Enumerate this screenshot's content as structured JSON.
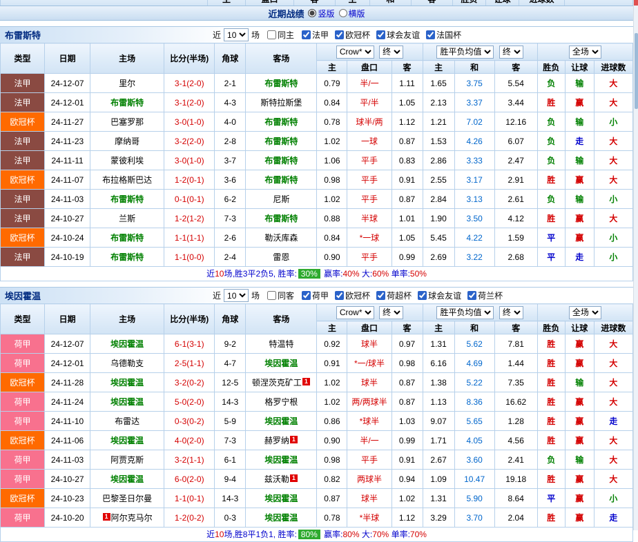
{
  "top_bar": {
    "title": "近期战绩",
    "vertical": "竖版",
    "horizontal": "横版"
  },
  "columns": {
    "type": "类型",
    "date": "日期",
    "home": "主场",
    "score": "比分(半场)",
    "corner": "角球",
    "away": "客场",
    "sub": [
      "主",
      "盘口",
      "客",
      "主",
      "和",
      "客",
      "胜负",
      "让球",
      "进球数"
    ]
  },
  "controls": {
    "company": "Crow*",
    "final_a": "终",
    "avg": "胜平负均值",
    "final_b": "终",
    "scope": "全场"
  },
  "colors": {
    "win": "#d40000",
    "draw": "#0000cc",
    "loss": "#008000",
    "league_ligue1": "#8a4a42",
    "league_ucl": "#ff6a00",
    "league_eredivisie": "#f8718e",
    "tracked_team": "#008000",
    "summary_badge": "#2eaa2e",
    "red_card_badge": "#e00000"
  },
  "sections": [
    {
      "team": "布雷斯特",
      "filter": {
        "prefix": "近",
        "count": "10",
        "suffix": "场",
        "same_label": "同主",
        "leagues": [
          "法甲",
          "欧冠杯",
          "球会友谊",
          "法国杯"
        ]
      },
      "rows": [
        {
          "type": "法甲",
          "date": "24-12-07",
          "home": "里尔",
          "home_t": false,
          "score": "3-1(2-0)",
          "corner": "2-1",
          "away": "布雷斯特",
          "away_t": true,
          "h1": "0.79",
          "hcap": "半/一",
          "h2": "1.11",
          "e1": "1.65",
          "e2": "3.75",
          "e3": "5.54",
          "r1": "负",
          "r2": "输",
          "r3": "大"
        },
        {
          "type": "法甲",
          "date": "24-12-01",
          "home": "布雷斯特",
          "home_t": true,
          "score": "3-1(2-0)",
          "corner": "4-3",
          "away": "斯特拉斯堡",
          "away_t": false,
          "h1": "0.84",
          "hcap": "平/半",
          "h2": "1.05",
          "e1": "2.13",
          "e2": "3.37",
          "e3": "3.44",
          "r1": "胜",
          "r2": "赢",
          "r3": "大"
        },
        {
          "type": "欧冠杯",
          "date": "24-11-27",
          "home": "巴塞罗那",
          "home_t": false,
          "score": "3-0(1-0)",
          "corner": "4-0",
          "away": "布雷斯特",
          "away_t": true,
          "h1": "0.78",
          "hcap": "球半/两",
          "h2": "1.12",
          "e1": "1.21",
          "e2": "7.02",
          "e3": "12.16",
          "r1": "负",
          "r2": "输",
          "r3": "小"
        },
        {
          "type": "法甲",
          "date": "24-11-23",
          "home": "摩纳哥",
          "home_t": false,
          "score": "3-2(2-0)",
          "corner": "2-8",
          "away": "布雷斯特",
          "away_t": true,
          "h1": "1.02",
          "hcap": "一球",
          "h2": "0.87",
          "e1": "1.53",
          "e2": "4.26",
          "e3": "6.07",
          "r1": "负",
          "r2": "走",
          "r3": "大"
        },
        {
          "type": "法甲",
          "date": "24-11-11",
          "home": "蒙彼利埃",
          "home_t": false,
          "score": "3-0(1-0)",
          "corner": "3-7",
          "away": "布雷斯特",
          "away_t": true,
          "h1": "1.06",
          "hcap": "平手",
          "h2": "0.83",
          "e1": "2.86",
          "e2": "3.33",
          "e3": "2.47",
          "r1": "负",
          "r2": "输",
          "r3": "大"
        },
        {
          "type": "欧冠杯",
          "date": "24-11-07",
          "home": "布拉格斯巴达",
          "home_t": false,
          "score": "1-2(0-1)",
          "corner": "3-6",
          "away": "布雷斯特",
          "away_t": true,
          "h1": "0.98",
          "hcap": "平手",
          "h2": "0.91",
          "e1": "2.55",
          "e2": "3.17",
          "e3": "2.91",
          "r1": "胜",
          "r2": "赢",
          "r3": "大"
        },
        {
          "type": "法甲",
          "date": "24-11-03",
          "home": "布雷斯特",
          "home_t": true,
          "score": "0-1(0-1)",
          "corner": "6-2",
          "away": "尼斯",
          "away_t": false,
          "h1": "1.02",
          "hcap": "平手",
          "h2": "0.87",
          "e1": "2.84",
          "e2": "3.13",
          "e3": "2.61",
          "r1": "负",
          "r2": "输",
          "r3": "小"
        },
        {
          "type": "法甲",
          "date": "24-10-27",
          "home": "兰斯",
          "home_t": false,
          "score": "1-2(1-2)",
          "corner": "7-3",
          "away": "布雷斯特",
          "away_t": true,
          "h1": "0.88",
          "hcap": "半球",
          "h2": "1.01",
          "e1": "1.90",
          "e2": "3.50",
          "e3": "4.12",
          "r1": "胜",
          "r2": "赢",
          "r3": "大"
        },
        {
          "type": "欧冠杯",
          "date": "24-10-24",
          "home": "布雷斯特",
          "home_t": true,
          "score": "1-1(1-1)",
          "corner": "2-6",
          "away": "勒沃库森",
          "away_t": false,
          "h1": "0.84",
          "hcap": "*一球",
          "h2": "1.05",
          "e1": "5.45",
          "e2": "4.22",
          "e3": "1.59",
          "r1": "平",
          "r2": "赢",
          "r3": "小"
        },
        {
          "type": "法甲",
          "date": "24-10-19",
          "home": "布雷斯特",
          "home_t": true,
          "score": "1-1(0-0)",
          "corner": "2-4",
          "away": "雷恩",
          "away_t": false,
          "h1": "0.90",
          "hcap": "平手",
          "h2": "0.99",
          "e1": "2.69",
          "e2": "3.22",
          "e3": "2.68",
          "r1": "平",
          "r2": "走",
          "r3": "小"
        }
      ],
      "summary": [
        {
          "t": "近",
          "c": "b"
        },
        {
          "t": "10",
          "c": "r"
        },
        {
          "t": "场,胜3平2负5, 胜率:",
          "c": "b"
        },
        {
          "t": "30%",
          "c": "w",
          "badge": true
        },
        {
          "t": " 赢率:",
          "c": "b"
        },
        {
          "t": "40%",
          "c": "r"
        },
        {
          "t": " 大:",
          "c": "b"
        },
        {
          "t": "60%",
          "c": "r"
        },
        {
          "t": " 单率:",
          "c": "b"
        },
        {
          "t": "50%",
          "c": "r"
        }
      ]
    },
    {
      "team": "埃因霍温",
      "filter": {
        "prefix": "近",
        "count": "10",
        "suffix": "场",
        "same_label": "同客",
        "leagues": [
          "荷甲",
          "欧冠杯",
          "荷超杯",
          "球会友谊",
          "荷兰杯"
        ]
      },
      "rows": [
        {
          "type": "荷甲",
          "date": "24-12-07",
          "home": "埃因霍温",
          "home_t": true,
          "score": "6-1(3-1)",
          "corner": "9-2",
          "away": "特温特",
          "away_t": false,
          "h1": "0.92",
          "hcap": "球半",
          "h2": "0.97",
          "e1": "1.31",
          "e2": "5.62",
          "e3": "7.81",
          "r1": "胜",
          "r2": "赢",
          "r3": "大"
        },
        {
          "type": "荷甲",
          "date": "24-12-01",
          "home": "乌德勒支",
          "home_t": false,
          "score": "2-5(1-1)",
          "corner": "4-7",
          "away": "埃因霍温",
          "away_t": true,
          "h1": "0.91",
          "hcap": "*一/球半",
          "h2": "0.98",
          "e1": "6.16",
          "e2": "4.69",
          "e3": "1.44",
          "r1": "胜",
          "r2": "赢",
          "r3": "大"
        },
        {
          "type": "欧冠杯",
          "date": "24-11-28",
          "home": "埃因霍温",
          "home_t": true,
          "score": "3-2(0-2)",
          "corner": "12-5",
          "away": "顿涅茨克矿工",
          "away_t": false,
          "away_b": "1",
          "h1": "1.02",
          "hcap": "球半",
          "h2": "0.87",
          "e1": "1.38",
          "e2": "5.22",
          "e3": "7.35",
          "r1": "胜",
          "r2": "输",
          "r3": "大"
        },
        {
          "type": "荷甲",
          "date": "24-11-24",
          "home": "埃因霍温",
          "home_t": true,
          "score": "5-0(2-0)",
          "corner": "14-3",
          "away": "格罗宁根",
          "away_t": false,
          "h1": "1.02",
          "hcap": "两/两球半",
          "h2": "0.87",
          "e1": "1.13",
          "e2": "8.36",
          "e3": "16.62",
          "r1": "胜",
          "r2": "赢",
          "r3": "大"
        },
        {
          "type": "荷甲",
          "date": "24-11-10",
          "home": "布雷达",
          "home_t": false,
          "score": "0-3(0-2)",
          "corner": "5-9",
          "away": "埃因霍温",
          "away_t": true,
          "h1": "0.86",
          "hcap": "*球半",
          "h2": "1.03",
          "e1": "9.07",
          "e2": "5.65",
          "e3": "1.28",
          "r1": "胜",
          "r2": "赢",
          "r3": "走"
        },
        {
          "type": "欧冠杯",
          "date": "24-11-06",
          "home": "埃因霍温",
          "home_t": true,
          "score": "4-0(2-0)",
          "corner": "7-3",
          "away": "赫罗纳",
          "away_t": false,
          "away_b": "1",
          "h1": "0.90",
          "hcap": "半/一",
          "h2": "0.99",
          "e1": "1.71",
          "e2": "4.05",
          "e3": "4.56",
          "r1": "胜",
          "r2": "赢",
          "r3": "大"
        },
        {
          "type": "荷甲",
          "date": "24-11-03",
          "home": "阿贾克斯",
          "home_t": false,
          "score": "3-2(1-1)",
          "corner": "6-1",
          "away": "埃因霍温",
          "away_t": true,
          "h1": "0.98",
          "hcap": "平手",
          "h2": "0.91",
          "e1": "2.67",
          "e2": "3.60",
          "e3": "2.41",
          "r1": "负",
          "r2": "输",
          "r3": "大"
        },
        {
          "type": "荷甲",
          "date": "24-10-27",
          "home": "埃因霍温",
          "home_t": true,
          "score": "6-0(2-0)",
          "corner": "9-4",
          "away": "兹沃勒",
          "away_t": false,
          "away_b": "1",
          "h1": "0.82",
          "hcap": "两球半",
          "h2": "0.94",
          "e1": "1.09",
          "e2": "10.47",
          "e3": "19.18",
          "r1": "胜",
          "r2": "赢",
          "r3": "大"
        },
        {
          "type": "欧冠杯",
          "date": "24-10-23",
          "home": "巴黎圣日尔曼",
          "home_t": false,
          "score": "1-1(0-1)",
          "corner": "14-3",
          "away": "埃因霍温",
          "away_t": true,
          "h1": "0.87",
          "hcap": "球半",
          "h2": "1.02",
          "e1": "1.31",
          "e2": "5.90",
          "e3": "8.64",
          "r1": "平",
          "r2": "赢",
          "r3": "小"
        },
        {
          "type": "荷甲",
          "date": "24-10-20",
          "home": "阿尔克马尔",
          "home_t": false,
          "home_b_pre": "1",
          "score": "1-2(0-2)",
          "corner": "0-3",
          "away": "埃因霍温",
          "away_t": true,
          "h1": "0.78",
          "hcap": "*半球",
          "h2": "1.12",
          "e1": "3.29",
          "e2": "3.70",
          "e3": "2.04",
          "r1": "胜",
          "r2": "赢",
          "r3": "走"
        }
      ],
      "summary": [
        {
          "t": "近",
          "c": "b"
        },
        {
          "t": "10",
          "c": "r"
        },
        {
          "t": "场,胜8平1负1, 胜率:",
          "c": "b"
        },
        {
          "t": "80%",
          "c": "w",
          "badge": true
        },
        {
          "t": " 赢率:",
          "c": "b"
        },
        {
          "t": "80%",
          "c": "r"
        },
        {
          "t": " 大:",
          "c": "b"
        },
        {
          "t": "70%",
          "c": "r"
        },
        {
          "t": " 单率:",
          "c": "b"
        },
        {
          "t": "70%",
          "c": "r"
        }
      ]
    }
  ]
}
